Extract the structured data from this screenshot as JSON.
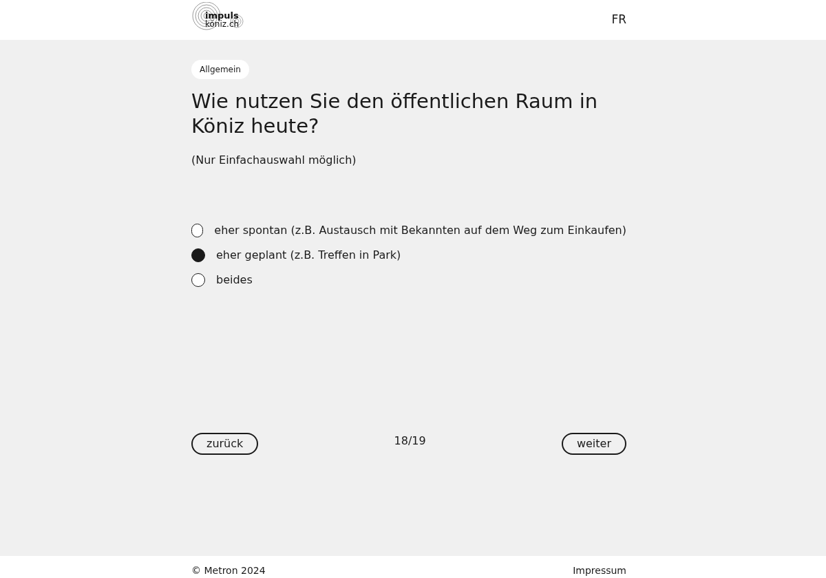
{
  "header": {
    "logo": {
      "line_1": "impuls",
      "line_2": "köniz.ch"
    },
    "language": "FR"
  },
  "question": {
    "category": "Allgemein",
    "title": "Wie nutzen Sie den öffentlichen Raum in Köniz heute?",
    "hint": "(Nur Einfachauswahl möglich)",
    "options": [
      {
        "label": "eher spontan (z.B. Austausch mit Bekannten auf dem Weg zum Einkaufen)",
        "selected": false
      },
      {
        "label": "eher geplant (z.B. Treffen in Park)",
        "selected": true
      },
      {
        "label": "beides",
        "selected": false
      }
    ]
  },
  "navigation": {
    "back": "zurück",
    "progress": "18/19",
    "next": "weiter"
  },
  "footer": {
    "copyright": "© Metron 2024",
    "link": "Impressum"
  }
}
